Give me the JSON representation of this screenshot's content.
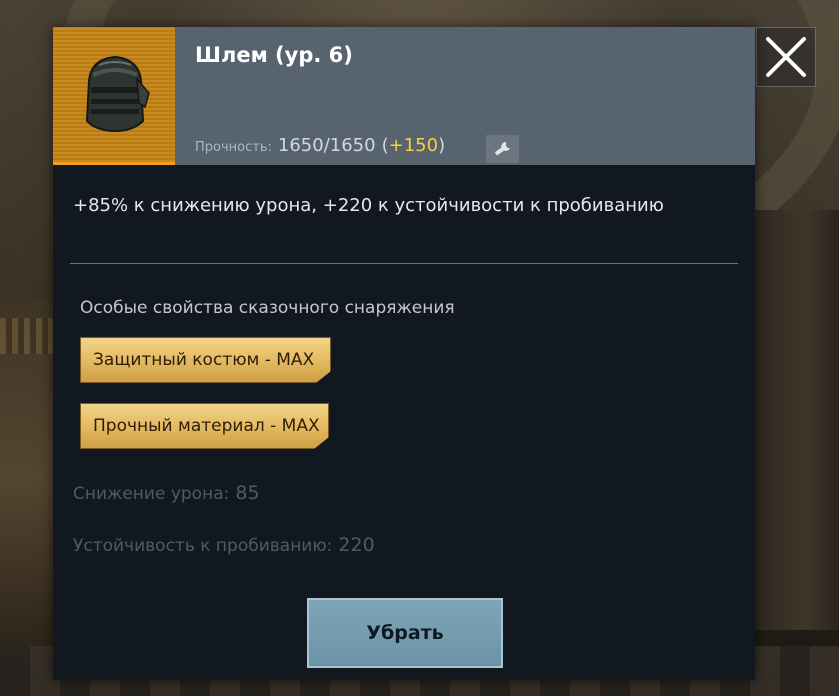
{
  "item": {
    "title": "Шлем (ур. 6)",
    "icon": "helmet-icon",
    "durability_label": "Прочность:",
    "durability_value": "1650/1650",
    "durability_open": "(",
    "durability_bonus": "+150",
    "durability_close": ")",
    "repair_icon": "wrench-icon"
  },
  "stats_summary": "+85% к снижению урона, +220 к устойчивости к пробиванию",
  "special": {
    "title": "Особые свойства сказочного снаряжения",
    "perks": [
      "Защитный костюм - MAX",
      "Прочный материал - MAX"
    ]
  },
  "stats": [
    {
      "label": "Снижение урона:",
      "value": "85"
    },
    {
      "label": "Устойчивость к пробиванию:",
      "value": "220"
    }
  ],
  "actions": {
    "remove_label": "Убрать",
    "close_icon": "close-icon"
  },
  "colors": {
    "header_bg": "#57636f",
    "panel_bg": "#121820",
    "item_frame": "#c98b1f",
    "bonus": "#f5d23c",
    "perk_gold": "#e2b85e",
    "button": "#7fa5b7"
  }
}
